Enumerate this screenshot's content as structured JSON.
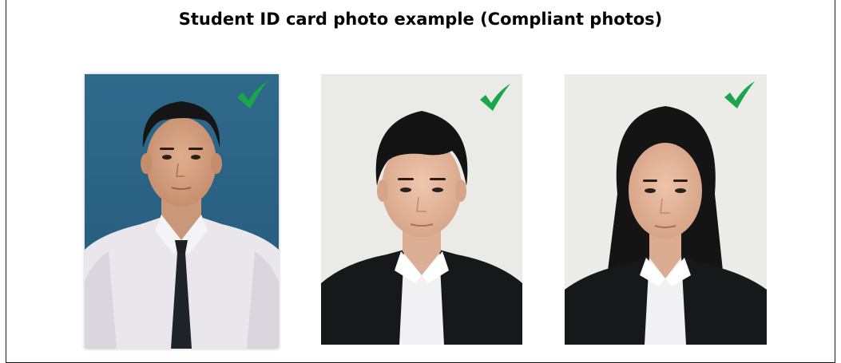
{
  "title": "Student ID card photo example (Compliant photos)",
  "colors": {
    "check": "#1aa64a",
    "photo1_background": "#2e6585",
    "photo2_background": "#eaeae7",
    "photo3_background": "#ebebe8",
    "suit": "#17181a",
    "white_shirt": "#e8e6ea",
    "tie": "#1c1f24",
    "hair": "#141414",
    "skin": "#d9a88a"
  },
  "photos": [
    {
      "subject": "male student in white short-sleeve shirt and dark tie",
      "background": "blue",
      "status": "compliant",
      "icon": "check-mark-icon"
    },
    {
      "subject": "male student in black suit and white polo",
      "background": "light gray",
      "status": "compliant",
      "icon": "check-mark-icon"
    },
    {
      "subject": "female student in black suit and white polo",
      "background": "light gray",
      "status": "compliant",
      "icon": "check-mark-icon"
    }
  ]
}
